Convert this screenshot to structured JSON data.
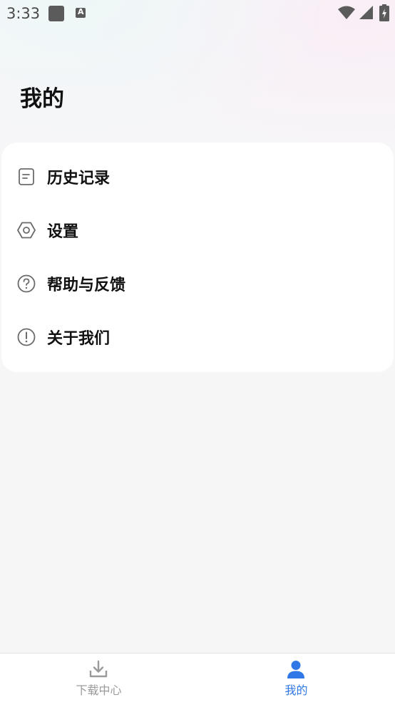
{
  "status_bar": {
    "time": "3:33",
    "icons": [
      "square-notification-icon",
      "a-notification-icon",
      "wifi-icon",
      "signal-icon",
      "battery-icon"
    ]
  },
  "header": {
    "title": "我的"
  },
  "menu": {
    "items": [
      {
        "label": "历史记录",
        "icon": "document-icon"
      },
      {
        "label": "设置",
        "icon": "settings-hexagon-icon"
      },
      {
        "label": "帮助与反馈",
        "icon": "help-circle-icon"
      },
      {
        "label": "关于我们",
        "icon": "info-exclamation-icon"
      }
    ]
  },
  "bottom_nav": {
    "items": [
      {
        "label": "下载中心",
        "icon": "download-icon",
        "active": false
      },
      {
        "label": "我的",
        "icon": "person-icon",
        "active": true
      }
    ],
    "active_color": "#2f78e6",
    "inactive_color": "#9a9a9a"
  }
}
